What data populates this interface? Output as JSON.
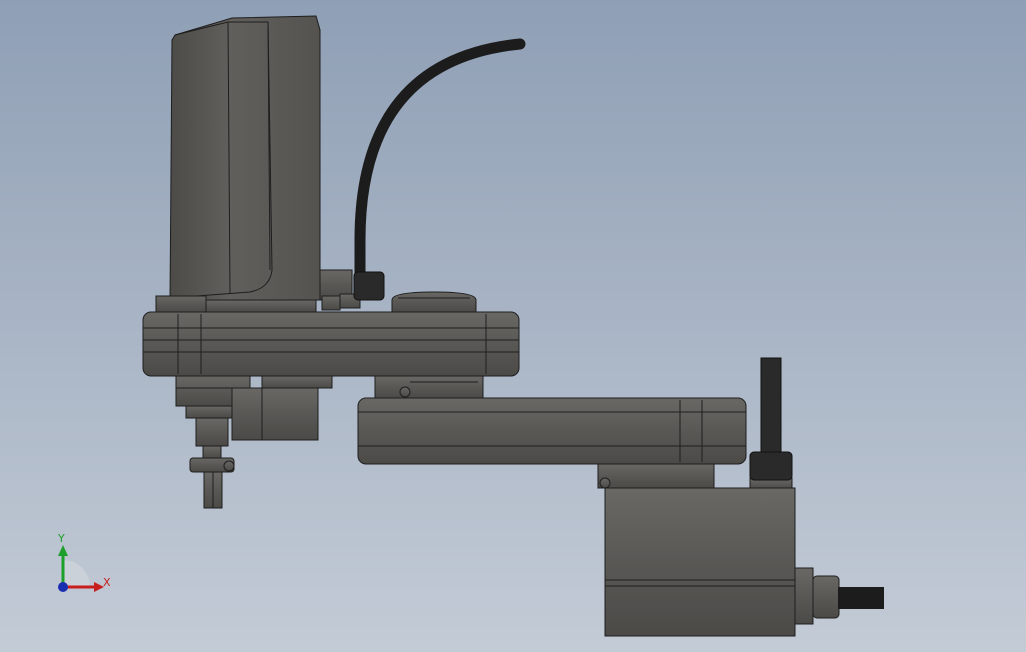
{
  "viewport": {
    "background_top": "#8f9fb5",
    "background_bottom": "#c3cbd6"
  },
  "model": {
    "body_color": "#5a5855",
    "edge_color": "#1e1e1e",
    "cable_color": "#1c1c1c"
  },
  "triad": {
    "x_label": "X",
    "y_label": "Y",
    "x_color": "#c81e1e",
    "y_color": "#1e9e2a",
    "z_color": "#1a2fb0"
  }
}
